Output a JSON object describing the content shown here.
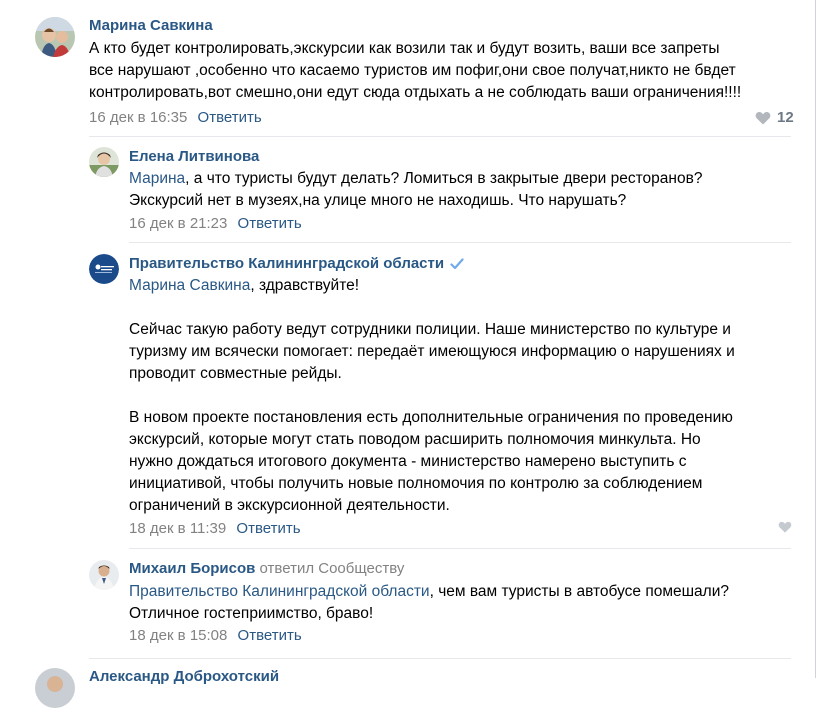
{
  "comments": [
    {
      "author": "Марина Савкина",
      "lines": [
        "А кто будет контролировать,экскурсии как возили так и будут возить, ваши все запреты",
        "все нарушают ,особенно что касаемо туристов им пофиг,они свое получат,никто не бвдет",
        "контролировать,вот смешно,они едут сюда отдыхать а не соблюдать ваши ограничения!!!!"
      ],
      "date": "16 дек в 16:35",
      "reply_label": "Ответить",
      "likes": "12"
    },
    {
      "author": "Елена Литвинова",
      "mention": "Марина",
      "line1_rest": ", а что туристы будут делать? Ломиться в закрытые двери ресторанов?",
      "line2": "Экскурсий нет в музеях,на улице много не находишь. Что нарушать?",
      "date": "16 дек в 21:23",
      "reply_label": "Ответить"
    },
    {
      "author": "Правительство Калининградской области",
      "mention": "Марина Савкина",
      "greeting_rest": ", здравствуйте!",
      "para1": [
        "Сейчас такую работу ведут сотрудники полиции. Наше министерство по культуре и",
        "туризму им всячески помогает: передаёт имеющуюся информацию о нарушениях и",
        "проводит совместные рейды."
      ],
      "para2": [
        "В новом проекте постановления есть дополнительные ограничения по проведению",
        "экскурсий, которые могут стать поводом расширить полномочия минкульта. Но",
        "нужно дождаться итогового документа - министерство намерено выступить с",
        "инициативой, чтобы получить новые полномочия по контролю за соблюдением",
        "ограничений в экскурсионной деятельности."
      ],
      "date": "18 дек в 11:39",
      "reply_label": "Ответить"
    },
    {
      "author": "Михаил Борисов",
      "replied_to": "ответил Сообществу",
      "mention": "Правительство Калининградской области",
      "line1_rest": ", чем вам туристы в автобусе помешали?",
      "line2": "Отличное гостеприимство, браво!",
      "date": "18 дек в 15:08",
      "reply_label": "Ответить"
    },
    {
      "author": "Александр Доброхотский"
    }
  ],
  "colors": {
    "link": "#2a5885",
    "meta": "#828282",
    "verified": "#71aaeb",
    "gov_avatar": "#1a4a8a"
  },
  "icons": [
    "heart-icon",
    "verified-icon"
  ]
}
